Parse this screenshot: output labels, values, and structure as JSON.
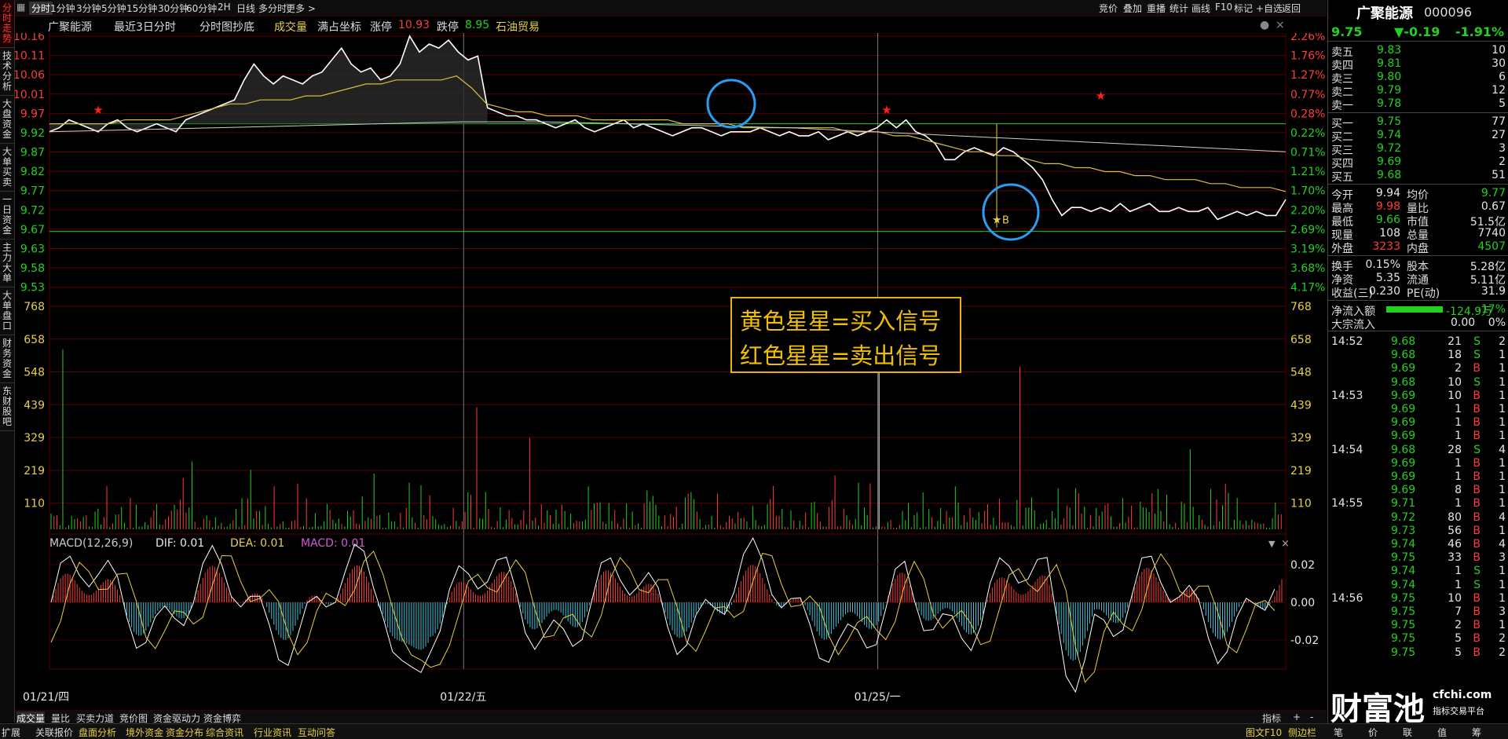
{
  "left_tabs": [
    "分时走势",
    "技术分析",
    "大盘资金",
    "大单买卖",
    "一日资金",
    "主力大单",
    "大单盘口",
    "财务资金",
    "东财股吧"
  ],
  "period_bar": {
    "items": [
      "分时",
      "1分钟",
      "3分钟",
      "5分钟",
      "15分钟",
      "30分钟",
      "60分钟",
      "2H",
      "日线",
      "多分时",
      "更多 >"
    ],
    "right_items": [
      "竞价",
      "叠加",
      "重播",
      "统计",
      "画线",
      "F10",
      "标记",
      "+自选",
      "返回"
    ]
  },
  "info": {
    "stock_name": "广聚能源",
    "range": "最近3日分时",
    "indicator_name": "分时图抄底",
    "volume_label": "成交量",
    "coord_label": "满占坐标",
    "limit_up_label": "涨停",
    "limit_up": "10.93",
    "limit_down_label": "跌停",
    "limit_down": "8.95",
    "sector": "石油贸易"
  },
  "chart_data": {
    "type": "line",
    "y_price_ticks": [
      "10.16",
      "10.11",
      "10.06",
      "10.01",
      "9.97",
      "9.92",
      "9.87",
      "9.82",
      "9.77",
      "9.72",
      "9.67",
      "9.63",
      "9.58",
      "9.53"
    ],
    "y_pct_ticks": [
      "2.26%",
      "1.76%",
      "1.27%",
      "0.77%",
      "0.28%",
      "0.22%",
      "0.71%",
      "1.21%",
      "1.70%",
      "2.20%",
      "2.69%",
      "3.19%",
      "3.68%",
      "4.17%"
    ],
    "volume_ticks": [
      "768",
      "658",
      "548",
      "439",
      "329",
      "219",
      "110"
    ],
    "macd_ticks": [
      "0.02",
      "0.00",
      "-0.02"
    ],
    "prev_close": 9.94,
    "ylim": [
      9.5,
      10.18
    ],
    "x_labels": [
      "01/21/四",
      "01/22/五",
      "01/25/一"
    ],
    "price": [
      9.92,
      9.93,
      9.95,
      9.94,
      9.93,
      9.92,
      9.94,
      9.95,
      9.93,
      9.92,
      9.93,
      9.94,
      9.93,
      9.92,
      9.95,
      9.96,
      9.97,
      9.98,
      9.99,
      10.0,
      10.05,
      10.09,
      10.06,
      10.04,
      10.06,
      10.05,
      10.04,
      10.06,
      10.07,
      10.1,
      10.13,
      10.09,
      10.07,
      10.08,
      10.05,
      10.06,
      10.09,
      10.16,
      10.12,
      10.14,
      10.13,
      10.15,
      10.12,
      10.1,
      10.11,
      9.98,
      9.97,
      9.96,
      9.96,
      9.95,
      9.95,
      9.94,
      9.93,
      9.94,
      9.95,
      9.93,
      9.92,
      9.93,
      9.94,
      9.95,
      9.93,
      9.94,
      9.93,
      9.92,
      9.91,
      9.92,
      9.93,
      9.93,
      9.92,
      9.91,
      9.92,
      9.92,
      9.92,
      9.93,
      9.92,
      9.91,
      9.92,
      9.91,
      9.91,
      9.92,
      9.9,
      9.91,
      9.92,
      9.91,
      9.92,
      9.93,
      9.95,
      9.93,
      9.95,
      9.92,
      9.91,
      9.89,
      9.85,
      9.85,
      9.87,
      9.88,
      9.87,
      9.86,
      9.88,
      9.87,
      9.85,
      9.83,
      9.8,
      9.75,
      9.71,
      9.73,
      9.73,
      9.72,
      9.73,
      9.72,
      9.74,
      9.72,
      9.73,
      9.74,
      9.72,
      9.72,
      9.73,
      9.72,
      9.72,
      9.73,
      9.7,
      9.71,
      9.72,
      9.71,
      9.72,
      9.71,
      9.71,
      9.75
    ],
    "avg": [
      9.94,
      9.94,
      9.94,
      9.94,
      9.94,
      9.95,
      9.95,
      9.95,
      9.95,
      9.96,
      9.97,
      9.98,
      9.99,
      9.99,
      10.0,
      10.0,
      10.0,
      10.01,
      10.01,
      10.02,
      10.03,
      10.04,
      10.04,
      10.05,
      10.05,
      10.05,
      10.05,
      10.06,
      10.03,
      9.99,
      9.98,
      9.97,
      9.97,
      9.96,
      9.96,
      9.96,
      9.95,
      9.95,
      9.95,
      9.95,
      9.95,
      9.95,
      9.94,
      9.94,
      9.94,
      9.94,
      9.93,
      9.93,
      9.93,
      9.93,
      9.93,
      9.93,
      9.93,
      9.92,
      9.92,
      9.92,
      9.91,
      9.91,
      9.9,
      9.89,
      9.88,
      9.87,
      9.87,
      9.86,
      9.86,
      9.85,
      9.84,
      9.84,
      9.83,
      9.83,
      9.82,
      9.82,
      9.81,
      9.81,
      9.8,
      9.8,
      9.8,
      9.79,
      9.79,
      9.78,
      9.78,
      9.78,
      9.77
    ],
    "annotation": [
      "黄色星星=买入信号",
      "红色星星=卖出信号"
    ],
    "macd_label": "MACD(12,26,9)",
    "dif_label": "DIF: 0.01",
    "dea_label": "DEA: 0.01",
    "macd_value_label": "MACD: 0.01",
    "marker_label": "B"
  },
  "bottom_tabs": [
    "成交量",
    "量比",
    "买卖力道",
    "竞价图",
    "资金驱动力",
    "资金博弈"
  ],
  "bottom_right": [
    "指标",
    "+",
    "-"
  ],
  "status_bar": [
    "扩展",
    "关联报价",
    "盘面分析",
    "境外资金",
    "资金分布",
    "综合资讯",
    "行业资讯",
    "互动问答"
  ],
  "status_right": [
    "图文F10",
    "侧边栏"
  ],
  "quote": {
    "name": "广聚能源",
    "code": "000096",
    "price": "9.75",
    "change": "▼-0.19",
    "change_pct": "-1.91%",
    "asks": [
      [
        "卖五",
        "9.83",
        "10"
      ],
      [
        "卖四",
        "9.81",
        "30"
      ],
      [
        "卖三",
        "9.80",
        "6"
      ],
      [
        "卖二",
        "9.79",
        "12"
      ],
      [
        "卖一",
        "9.78",
        "5"
      ]
    ],
    "bids": [
      [
        "买一",
        "9.75",
        "77"
      ],
      [
        "买二",
        "9.74",
        "27"
      ],
      [
        "买三",
        "9.72",
        "3"
      ],
      [
        "买四",
        "9.69",
        "2"
      ],
      [
        "买五",
        "9.68",
        "51"
      ]
    ],
    "stats": [
      [
        "今开",
        "9.94",
        "均价",
        "9.77"
      ],
      [
        "最高",
        "9.98",
        "量比",
        "0.67"
      ],
      [
        "最低",
        "9.66",
        "市值",
        "51.5亿"
      ],
      [
        "现量",
        "108",
        "总量",
        "7740"
      ],
      [
        "外盘",
        "3233",
        "内盘",
        "4507"
      ]
    ],
    "stats2": [
      [
        "换手",
        "0.15%",
        "股本",
        "5.28亿"
      ],
      [
        "净资",
        "5.35",
        "流通",
        "5.11亿"
      ],
      [
        "收益(三)",
        "0.230",
        "PE(动)",
        "31.9"
      ]
    ],
    "netflow_label": "净流入额",
    "netflow_value": "-124.9万",
    "netflow_pct": "-17%",
    "block_label": "大宗流入",
    "block_value": "0.00",
    "block_pct": "0%"
  },
  "ticks": [
    [
      "14:52",
      "9.68",
      "21",
      "S",
      "2"
    ],
    [
      "",
      "9.68",
      "18",
      "S",
      "1"
    ],
    [
      "",
      "9.69",
      "2",
      "B",
      "1"
    ],
    [
      "",
      "9.68",
      "10",
      "S",
      "1"
    ],
    [
      "14:53",
      "9.69",
      "10",
      "B",
      "1"
    ],
    [
      "",
      "9.69",
      "1",
      "B",
      "1"
    ],
    [
      "",
      "9.69",
      "1",
      "B",
      "1"
    ],
    [
      "",
      "9.69",
      "1",
      "B",
      "1"
    ],
    [
      "14:54",
      "9.68",
      "28",
      "S",
      "4"
    ],
    [
      "",
      "9.69",
      "1",
      "B",
      "1"
    ],
    [
      "",
      "9.69",
      "1",
      "B",
      "1"
    ],
    [
      "",
      "9.69",
      "8",
      "B",
      "1"
    ],
    [
      "14:55",
      "9.71",
      "1",
      "B",
      "1"
    ],
    [
      "",
      "9.72",
      "80",
      "B",
      "4"
    ],
    [
      "",
      "9.73",
      "56",
      "B",
      "1"
    ],
    [
      "",
      "9.74",
      "46",
      "B",
      "4"
    ],
    [
      "",
      "9.75",
      "33",
      "B",
      "3"
    ],
    [
      "",
      "9.74",
      "1",
      "S",
      "1"
    ],
    [
      "",
      "9.74",
      "1",
      "S",
      "1"
    ],
    [
      "14:56",
      "9.75",
      "10",
      "B",
      "1"
    ],
    [
      "",
      "9.75",
      "7",
      "B",
      "3"
    ],
    [
      "",
      "9.75",
      "2",
      "B",
      "1"
    ],
    [
      "",
      "9.75",
      "5",
      "B",
      "2"
    ],
    [
      "",
      "9.75",
      "5",
      "B",
      "2"
    ]
  ],
  "side_tabs": [
    "笔",
    "价",
    "联",
    "值",
    "筹"
  ],
  "logo": {
    "main": "财富池",
    "site": "cfchi.com",
    "sub": "指标交易平台"
  },
  "colors": {
    "up": "#ff3b3b",
    "down": "#22d022",
    "price_line": "#ffffff",
    "avg_line": "#e0c040",
    "grid": "#5a0000"
  }
}
